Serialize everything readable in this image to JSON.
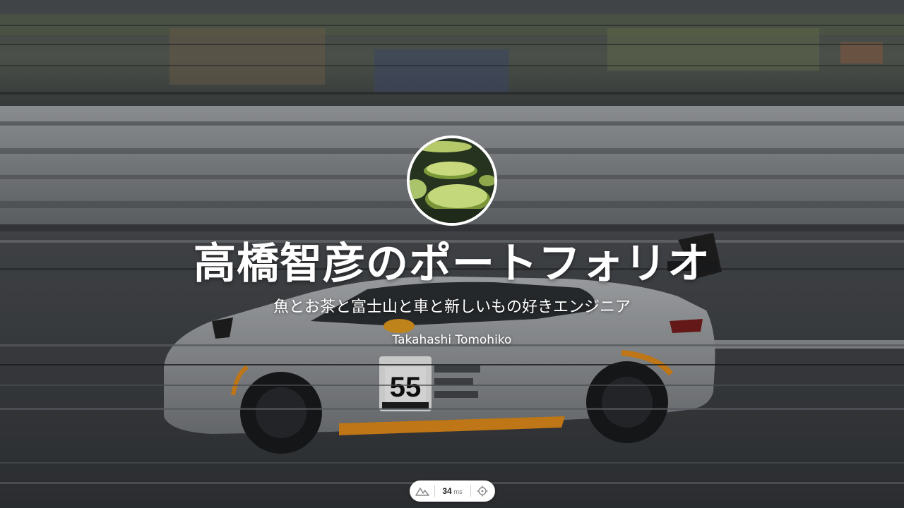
{
  "hero": {
    "background_image": "race-car-photo"
  },
  "profile": {
    "avatar_image": "water-lily-pads-photo",
    "title": "高橋智彦のポートフォリオ",
    "subtitle": "魚とお茶と富士山と車と新しいもの好きエンジニア",
    "author": "Takahashi Tomohiko"
  },
  "toolbar": {
    "logo_icon": "nuxt-logo-icon",
    "render_time_value": "34",
    "render_time_unit": "ms",
    "inspect_icon": "crosshair-icon"
  },
  "colors": {
    "text": "#ffffff",
    "car_orange": "#e8901c",
    "pill_bg": "#ffffff"
  }
}
